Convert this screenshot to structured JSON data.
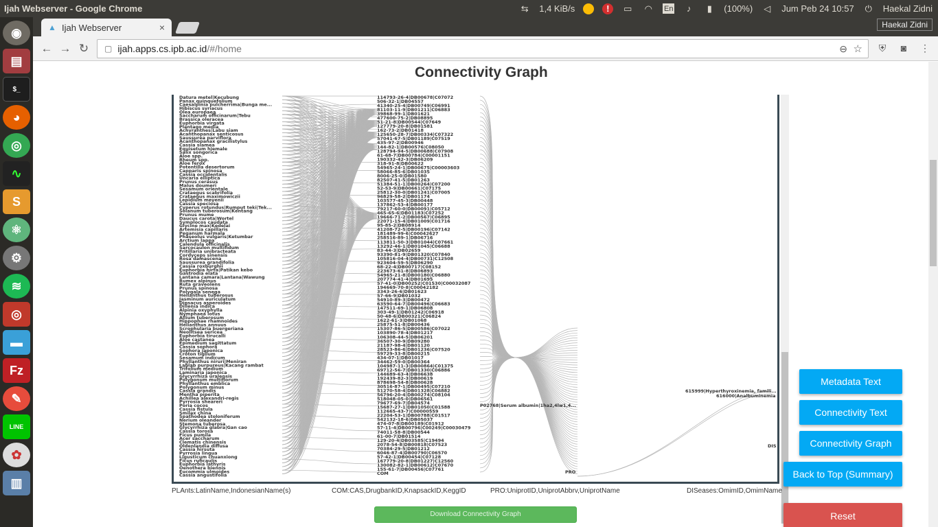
{
  "os": {
    "window_title": "Ijah Webserver - Google Chrome",
    "net_speed": "1,4 KiB/s",
    "keyboard": "En",
    "battery": "(100%)",
    "clock": "Jum Peb 24 10:57",
    "user": "Haekal Zidni"
  },
  "browser": {
    "tab_title": "Ijah Webserver",
    "tab_close": "×",
    "profile_name": "Haekal Zidni",
    "url_host": "ijah.apps.cs.ipb.ac.id",
    "url_path": "/#/home"
  },
  "page": {
    "title": "Connectivity Graph",
    "axis_labels": [
      "PLAnts:LatinName,IndonesianName(s)",
      "COM:CAS,DrugbankID,KnapsackID,KeggID",
      "PRO:UniprotID,UniprotAbbrv,UniprotName",
      "DISeases:OmimID,OmimName"
    ],
    "download_label": "Download Connectivity Graph",
    "buttons": {
      "metadata_text": "Metadata Text",
      "connectivity_text": "Connectivity Text",
      "connectivity_graph": "Connectivity Graph",
      "back_to_top": "Back to Top (Summary)",
      "reset": "Reset"
    }
  },
  "graph": {
    "plants": [
      "Datura metel|Kecubung",
      "Panax quinquefolium",
      "Caesalpinia pulcherrima|Bunga me...",
      "Hibiscus syriacus",
      "Olea europaea",
      "Saccharum officinarum|Tebu",
      "Brassica oleracea",
      "Euphorbia virgata",
      "Plantago media",
      "Achyranthes|Labu siam",
      "Acanthopanax senticosus",
      "Saussurea parviflora",
      "Acanthopanax gracilistylus",
      "Cassia siamea",
      "Equisetum hiemale",
      "Salix songorica",
      "Aloe spp.",
      "Rheum spp.",
      "Aloe ferox",
      "Potentilla desertorum",
      "Capparis spinosa",
      "Cassia occidentalis",
      "Uncaria elliptica",
      "Prunus cerasus",
      "Malus doumeri",
      "Sesamum orientale",
      "Crataegus scabrifolia",
      "Crataegus maximowiczii",
      "Lepidium meyenii",
      "Cassia speciosa",
      "Cyperus rotundus|Rumput teki|Tek...",
      "Solanum tuberosum|Kentang",
      "Prunus mume",
      "Daucus carota|Wortel",
      "Symplocos caudata",
      "Glycine max|Kedelai",
      "Artemisia capillaris",
      "Peganum harmala",
      "Phaseolus vulgaris|Ketumbar",
      "Arctium lappa",
      "Calendula officinalis",
      "Sarcocaulon multifidum",
      "Fritillaria unibracteata",
      "Cordyceps sinensis",
      "Rosa damascena",
      "Saussurea grandifolia",
      "Cassia roxburghii",
      "Euphorbia hirta|Patikan kebo",
      "Gastrodia elata",
      "Lantana camara|Lantana|Wawung",
      "Rumex alpinus",
      "Ruta graveolens",
      "Prunus spinosa",
      "Polygala senega",
      "Helianthus tuberosus",
      "Jasminum auriculatum",
      "Dipsacus asperoides",
      "Dillenia indica",
      "Alpinia oxyphylla",
      "Nymphaea lotus",
      "Allium tuberosum",
      "Hippophae rhamnoides",
      "Helianthus annuus",
      "Scrophularia buergeriana",
      "Neolitsea sericea",
      "Euphorbia tirucalli",
      "Aloe castanea",
      "Epimedium sagittatum",
      "Cassia sophora",
      "Sophora japonica",
      "Croton tiglium",
      "Sesamum indicum",
      "Phyllanthus niruri|Meniran",
      "Lablab purpureus|Kacang rambat",
      "Trifolium medium",
      "Laminaria japonica",
      "Glycyrrhiza uralensis",
      "Polygonum multiflorum",
      "Phyllanthus emblica",
      "Polygonum minus",
      "Cassia grandis",
      "Mentha piperita",
      "Achillea alexandri-regis",
      "Pyrrosia sheareri",
      "Poria cocos",
      "Cassia fistula",
      "Smilax china",
      "Spathodea stoloniferum",
      "Nerium oleander",
      "Stemona tuberosa",
      "Glycyrrhiza glabra|Gan cao",
      "Cassia torosa",
      "Ficus pumila",
      "Acer saccharum",
      "Clematis chinensis",
      "Oldenlandia diffusa",
      "Cassia hirsuta",
      "Pyrrosia lingua",
      "Ligusticum chuanxiong",
      "Ficus ruficaulis",
      "Euphorbia lathyris",
      "Oenothera biennis",
      "Eucommia ulmoides",
      "Cassia angustifolia"
    ],
    "compounds": [
      "114793-26-4|DB00678|C07072",
      "506-32-1|DB04557",
      "41340-25-4|DB00749|C06991",
      "81103-11-9|DB01211|C06883",
      "39868-99-1|DB01621",
      "477600-75-2|DB08895",
      "51-21-8|DB00544|C07649",
      "127779-20-8|DB01581",
      "162-73-2|DB01418",
      "125650-28-7|DB00334|C07322",
      "57041-67-5|DB01189|C07519",
      "435-97-2|DB00946",
      "144-82-1|DB00576|C08050",
      "128794-94-5|DB00688|C07908",
      "61-68-7|DB00784|C00001151",
      "190332-42-3|DB06209",
      "318-91-8|DB00622",
      "54965-24-1|DB00675|C00003603",
      "58066-85-6|DB01035",
      "8006-25-0|DB01580",
      "82507-41-5|DB01263",
      "51384-51-1|DB00264|C07200",
      "52-53-9|DB00661|C07175",
      "25812-30-0|DB01241|C07005",
      "96829-58-2|DB01174",
      "103577-45-3|DB00448",
      "137862-53-4|DB00177",
      "79217-60-0|DB00091|C05712",
      "465-65-6|DB01183|C07252",
      "19666-71-2|DB00567|C06895",
      "22071-15-4|DB01009|C01716",
      "95-85-2|DB08914",
      "41208-72-5|DB00196|C07142",
      "181489-99-6|C00042627",
      "258516-89-1|DB06716",
      "113811-50-3|DB01044|C07661",
      "13292-46-1|DB01045|C06688",
      "83-44-3|DB02659",
      "93390-81-9|DB01320|C07840",
      "105816-04-4|DB00731|C12508",
      "923604-59-5|DB06290",
      "68-22-4|DB00717|C08152",
      "223673-61-8|DB06893",
      "54965-21-8|DB00180|C06880",
      "207774-41-4|DB01695",
      "57-41-0|DB00252|C01530|C00032087",
      "194669-70-8|C00042182",
      "3343-26-6|DB01623",
      "57-66-9|DB01032",
      "54910-89-3|DB00472",
      "63590-64-7|DB00496|C06683",
      "147511-69-1|DB06808",
      "303-49-1|DB01242|C06918",
      "50-48-6|DB00321|C06824",
      "1622-61-3|DB01068",
      "25875-51-8|DB00436",
      "15307-86-5|DB00586|C07022",
      "103890-78-4|DB01217",
      "106308-44-5|DB06201",
      "36507-30-9|DB09280",
      "21187-98-4|DB01120",
      "28523-86-6|DB01236|C07520",
      "59729-33-8|DB00215",
      "434-07-1|DB01017",
      "34462-59-0|DB00364",
      "104987-11-3|DB00864|C01375",
      "69712-56-7|DB01330|C06886",
      "144689-63-4|DB06638",
      "192439-82-3|DB00619",
      "878698-54-8|DB00628",
      "30516-87-1|DB00495|C07210",
      "51270-58-4|DB01328|C06882",
      "56796-20-4|DB00274|C08104",
      "518048-05-0|DB06561",
      "79677-69-7|DB04574",
      "15687-27-1|DB01050|C01588",
      "112665-43-7|C00000559",
      "22204-53-1|DB00788|C01517",
      "542132-18-6|DB05037",
      "474-07-8|DB00189|C01912",
      "57-11-4|DB00796|C00249|C00030479",
      "74011-58-8|DB00544",
      "61-00-7|DB01514",
      "129-20-4|DB03585|C19494",
      "2078-54-8|DB00818|C07523",
      "70384-29-5|DB01212",
      "6046-87-4|DB00790|C06570",
      "57-42-1|DB00454|C07128",
      "167779-20-8|DB01227|C12560",
      "130082-82-1|DB00612|C07670",
      "155-61-7|DB00456|C07761",
      "COM"
    ],
    "protein_hub": "P02768|Serum albumin|1ha2,4lw1,4...",
    "protein_axis": "PRO",
    "diseases": [
      "615999|Hyperthyroxinemia, famili...",
      "616000|Analbuminemia"
    ],
    "disease_axis": "DIS"
  }
}
